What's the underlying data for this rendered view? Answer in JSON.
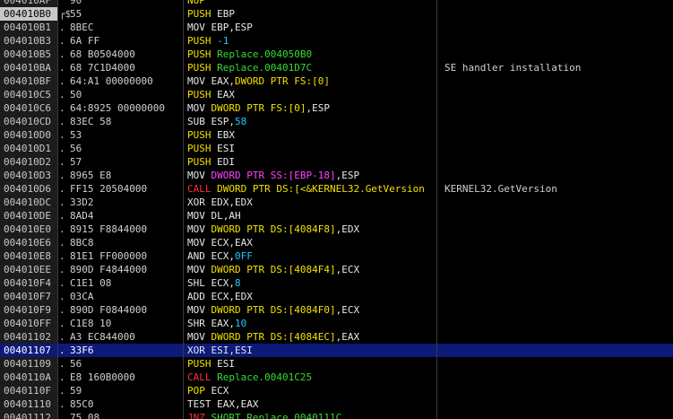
{
  "colors": {
    "background": "#000000",
    "selected_row": "#0c1a7a",
    "push_mnemonic": "#f0e000",
    "call_mnemonic": "#ff3030",
    "jump_mnemonic": "#ff3030",
    "default_mnemonic": "#e8e8e8",
    "address_operand": "#33dd33",
    "constant_operand": "#20c8ff",
    "stack_operand": "#ff40ff",
    "memory_operand": "#f0e000"
  },
  "rows": [
    {
      "addr": "004010AF",
      "mark": "",
      "hex": "90",
      "mn": "NOP",
      "mc": "yellow",
      "parts": [],
      "cmt": ""
    },
    {
      "addr": "004010B0",
      "mark": "┌$",
      "hex": "55",
      "mn": "PUSH",
      "mc": "yellow",
      "parts": [
        {
          "t": "EBP",
          "c": "white"
        }
      ],
      "cmt": "",
      "current": true
    },
    {
      "addr": "004010B1",
      "mark": ".",
      "hex": "8BEC",
      "mn": "MOV",
      "mc": "white",
      "parts": [
        {
          "t": "EBP,ESP",
          "c": "white"
        }
      ],
      "cmt": ""
    },
    {
      "addr": "004010B3",
      "mark": ".",
      "hex": "6A FF",
      "mn": "PUSH",
      "mc": "yellow",
      "parts": [
        {
          "t": "-1",
          "c": "cyan"
        }
      ],
      "cmt": ""
    },
    {
      "addr": "004010B5",
      "mark": ".",
      "hex": "68 B0504000",
      "mn": "PUSH",
      "mc": "yellow",
      "parts": [
        {
          "t": "Replace.004050B0",
          "c": "green"
        }
      ],
      "cmt": ""
    },
    {
      "addr": "004010BA",
      "mark": ".",
      "hex": "68 7C1D4000",
      "mn": "PUSH",
      "mc": "yellow",
      "parts": [
        {
          "t": "Replace.00401D7C",
          "c": "green"
        }
      ],
      "cmt": "SE handler installation"
    },
    {
      "addr": "004010BF",
      "mark": ".",
      "hex": "64:A1 00000000",
      "mn": "MOV",
      "mc": "white",
      "parts": [
        {
          "t": "EAX,",
          "c": "white"
        },
        {
          "t": "DWORD PTR FS:[0]",
          "c": "yellow"
        }
      ],
      "cmt": ""
    },
    {
      "addr": "004010C5",
      "mark": ".",
      "hex": "50",
      "mn": "PUSH",
      "mc": "yellow",
      "parts": [
        {
          "t": "EAX",
          "c": "white"
        }
      ],
      "cmt": ""
    },
    {
      "addr": "004010C6",
      "mark": ".",
      "hex": "64:8925 00000000",
      "mn": "MOV",
      "mc": "white",
      "parts": [
        {
          "t": "DWORD PTR FS:[0]",
          "c": "yellow"
        },
        {
          "t": ",ESP",
          "c": "white"
        }
      ],
      "cmt": ""
    },
    {
      "addr": "004010CD",
      "mark": ".",
      "hex": "83EC 58",
      "mn": "SUB",
      "mc": "white",
      "parts": [
        {
          "t": "ESP,",
          "c": "white"
        },
        {
          "t": "58",
          "c": "cyan"
        }
      ],
      "cmt": ""
    },
    {
      "addr": "004010D0",
      "mark": ".",
      "hex": "53",
      "mn": "PUSH",
      "mc": "yellow",
      "parts": [
        {
          "t": "EBX",
          "c": "white"
        }
      ],
      "cmt": ""
    },
    {
      "addr": "004010D1",
      "mark": ".",
      "hex": "56",
      "mn": "PUSH",
      "mc": "yellow",
      "parts": [
        {
          "t": "ESI",
          "c": "white"
        }
      ],
      "cmt": ""
    },
    {
      "addr": "004010D2",
      "mark": ".",
      "hex": "57",
      "mn": "PUSH",
      "mc": "yellow",
      "parts": [
        {
          "t": "EDI",
          "c": "white"
        }
      ],
      "cmt": ""
    },
    {
      "addr": "004010D3",
      "mark": ".",
      "hex": "8965 E8",
      "mn": "MOV",
      "mc": "white",
      "parts": [
        {
          "t": "DWORD PTR SS:[EBP-18]",
          "c": "magenta"
        },
        {
          "t": ",ESP",
          "c": "white"
        }
      ],
      "cmt": ""
    },
    {
      "addr": "004010D6",
      "mark": ".",
      "hex": "FF15 20504000",
      "mn": "CALL",
      "mc": "red",
      "parts": [
        {
          "t": "DWORD PTR DS:[<&KERNEL32.GetVersion",
          "c": "yellow"
        }
      ],
      "cmt": "KERNEL32.GetVersion"
    },
    {
      "addr": "004010DC",
      "mark": ".",
      "hex": "33D2",
      "mn": "XOR",
      "mc": "white",
      "parts": [
        {
          "t": "EDX,EDX",
          "c": "white"
        }
      ],
      "cmt": ""
    },
    {
      "addr": "004010DE",
      "mark": ".",
      "hex": "8AD4",
      "mn": "MOV",
      "mc": "white",
      "parts": [
        {
          "t": "DL,AH",
          "c": "white"
        }
      ],
      "cmt": ""
    },
    {
      "addr": "004010E0",
      "mark": ".",
      "hex": "8915 F8844000",
      "mn": "MOV",
      "mc": "white",
      "parts": [
        {
          "t": "DWORD PTR DS:[4084F8]",
          "c": "yellow"
        },
        {
          "t": ",EDX",
          "c": "white"
        }
      ],
      "cmt": ""
    },
    {
      "addr": "004010E6",
      "mark": ".",
      "hex": "8BC8",
      "mn": "MOV",
      "mc": "white",
      "parts": [
        {
          "t": "ECX,EAX",
          "c": "white"
        }
      ],
      "cmt": ""
    },
    {
      "addr": "004010E8",
      "mark": ".",
      "hex": "81E1 FF000000",
      "mn": "AND",
      "mc": "white",
      "parts": [
        {
          "t": "ECX,",
          "c": "white"
        },
        {
          "t": "0FF",
          "c": "cyan"
        }
      ],
      "cmt": ""
    },
    {
      "addr": "004010EE",
      "mark": ".",
      "hex": "890D F4844000",
      "mn": "MOV",
      "mc": "white",
      "parts": [
        {
          "t": "DWORD PTR DS:[4084F4]",
          "c": "yellow"
        },
        {
          "t": ",ECX",
          "c": "white"
        }
      ],
      "cmt": ""
    },
    {
      "addr": "004010F4",
      "mark": ".",
      "hex": "C1E1 08",
      "mn": "SHL",
      "mc": "white",
      "parts": [
        {
          "t": "ECX,",
          "c": "white"
        },
        {
          "t": "8",
          "c": "cyan"
        }
      ],
      "cmt": ""
    },
    {
      "addr": "004010F7",
      "mark": ".",
      "hex": "03CA",
      "mn": "ADD",
      "mc": "white",
      "parts": [
        {
          "t": "ECX,EDX",
          "c": "white"
        }
      ],
      "cmt": ""
    },
    {
      "addr": "004010F9",
      "mark": ".",
      "hex": "890D F0844000",
      "mn": "MOV",
      "mc": "white",
      "parts": [
        {
          "t": "DWORD PTR DS:[4084F0]",
          "c": "yellow"
        },
        {
          "t": ",ECX",
          "c": "white"
        }
      ],
      "cmt": ""
    },
    {
      "addr": "004010FF",
      "mark": ".",
      "hex": "C1E8 10",
      "mn": "SHR",
      "mc": "white",
      "parts": [
        {
          "t": "EAX,",
          "c": "white"
        },
        {
          "t": "10",
          "c": "cyan"
        }
      ],
      "cmt": ""
    },
    {
      "addr": "00401102",
      "mark": ".",
      "hex": "A3 EC844000",
      "mn": "MOV",
      "mc": "white",
      "parts": [
        {
          "t": "DWORD PTR DS:[4084EC]",
          "c": "yellow"
        },
        {
          "t": ",EAX",
          "c": "white"
        }
      ],
      "cmt": ""
    },
    {
      "addr": "00401107",
      "mark": ".",
      "hex": "33F6",
      "mn": "XOR",
      "mc": "white",
      "parts": [
        {
          "t": "ESI,ESI",
          "c": "white"
        }
      ],
      "cmt": "",
      "selected": true
    },
    {
      "addr": "00401109",
      "mark": ".",
      "hex": "56",
      "mn": "PUSH",
      "mc": "yellow",
      "parts": [
        {
          "t": "ESI",
          "c": "white"
        }
      ],
      "cmt": ""
    },
    {
      "addr": "0040110A",
      "mark": ".",
      "hex": "E8 160B0000",
      "mn": "CALL",
      "mc": "red",
      "parts": [
        {
          "t": "Replace.00401C25",
          "c": "green"
        }
      ],
      "cmt": ""
    },
    {
      "addr": "0040110F",
      "mark": ".",
      "hex": "59",
      "mn": "POP",
      "mc": "yellow",
      "parts": [
        {
          "t": "ECX",
          "c": "white"
        }
      ],
      "cmt": ""
    },
    {
      "addr": "00401110",
      "mark": ".",
      "hex": "85C0",
      "mn": "TEST",
      "mc": "white",
      "parts": [
        {
          "t": "EAX,EAX",
          "c": "white"
        }
      ],
      "cmt": ""
    },
    {
      "addr": "00401112",
      "mark": ".",
      "hex": "75 08",
      "mn": "JNZ",
      "mc": "red",
      "parts": [
        {
          "t": "SHORT Replace.0040111C",
          "c": "green"
        }
      ],
      "cmt": ""
    }
  ]
}
